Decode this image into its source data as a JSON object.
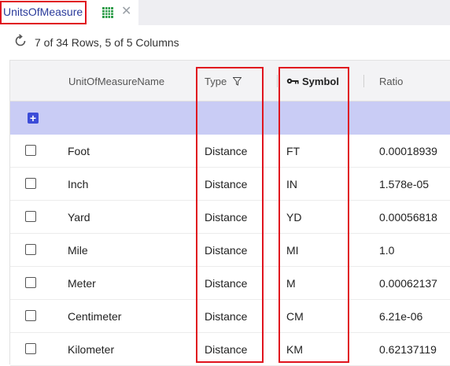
{
  "tab": {
    "title": "UnitsOfMeasure"
  },
  "toolbar": {
    "status": "7 of 34 Rows, 5 of 5 Columns"
  },
  "columns": [
    {
      "label": "UnitOfMeasureName"
    },
    {
      "label": "Type"
    },
    {
      "label": "Symbol"
    },
    {
      "label": "Ratio"
    }
  ],
  "add_row": {
    "label": "+"
  },
  "rows": [
    {
      "name": "Foot",
      "type": "Distance",
      "symbol": "FT",
      "ratio": "0.00018939"
    },
    {
      "name": "Inch",
      "type": "Distance",
      "symbol": "IN",
      "ratio": "1.578e-05"
    },
    {
      "name": "Yard",
      "type": "Distance",
      "symbol": "YD",
      "ratio": "0.00056818"
    },
    {
      "name": "Mile",
      "type": "Distance",
      "symbol": "MI",
      "ratio": "1.0"
    },
    {
      "name": "Meter",
      "type": "Distance",
      "symbol": "M",
      "ratio": "0.00062137"
    },
    {
      "name": "Centimeter",
      "type": "Distance",
      "symbol": "CM",
      "ratio": "6.21e-06"
    },
    {
      "name": "Kilometer",
      "type": "Distance",
      "symbol": "KM",
      "ratio": "0.62137119"
    }
  ],
  "colors": {
    "highlight": "#e0141e",
    "accent": "#3c4cd8",
    "add_row_bg": "#c9ccf5",
    "tab_text": "#2a3b9b"
  }
}
